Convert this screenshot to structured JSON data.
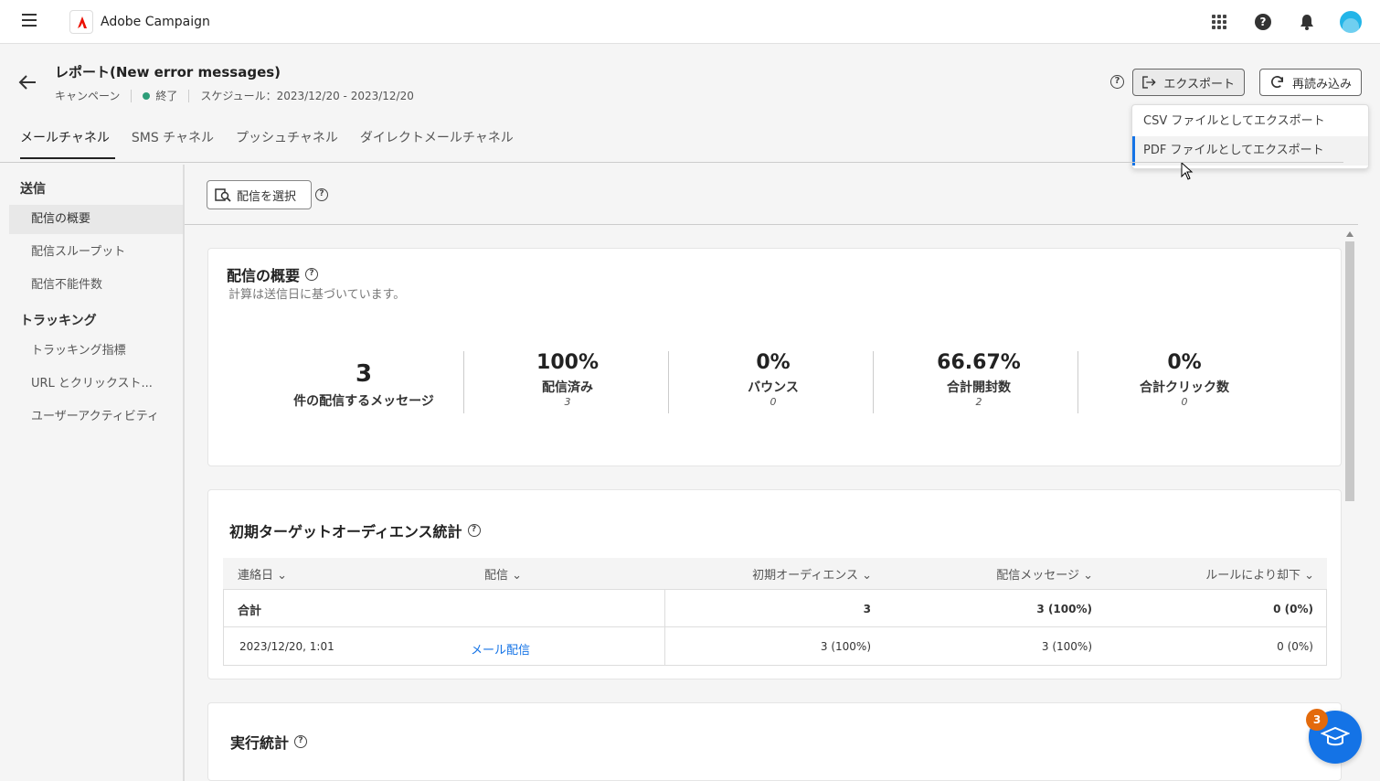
{
  "app": {
    "name": "Adobe Campaign"
  },
  "header": {
    "title": "レポート(New error messages)",
    "breadcrumb": "キャンペーン",
    "status": "終了",
    "schedule": "スケジュール：2023/12/20 - 2023/12/20",
    "export_label": "エクスポート",
    "reload_label": "再読み込み"
  },
  "export_menu": {
    "items": [
      {
        "label": "CSV ファイルとしてエクスポート"
      },
      {
        "label": "PDF ファイルとしてエクスポート"
      }
    ]
  },
  "tabs": [
    {
      "label": "メールチャネル"
    },
    {
      "label": "SMS チャネル"
    },
    {
      "label": "プッシュチャネル"
    },
    {
      "label": "ダイレクトメールチャネル"
    }
  ],
  "sidebar": {
    "section1": "送信",
    "section2": "トラッキング",
    "items": [
      {
        "label": "配信の概要"
      },
      {
        "label": "配信スループット"
      },
      {
        "label": "配信不能件数"
      },
      {
        "label": "トラッキング指標"
      },
      {
        "label": "URL とクリックスト..."
      },
      {
        "label": "ユーザーアクティビティ"
      }
    ]
  },
  "select_delivery_label": "配信を選択",
  "overview": {
    "title": "配信の概要",
    "subtitle": "計算は送信日に基づいています。",
    "kpis": [
      {
        "value": "3",
        "label": "件の配信するメッセージ",
        "sub": ""
      },
      {
        "value": "100%",
        "label": "配信済み",
        "sub": "3"
      },
      {
        "value": "0%",
        "label": "バウンス",
        "sub": "0"
      },
      {
        "value": "66.67%",
        "label": "合計開封数",
        "sub": "2"
      },
      {
        "value": "0%",
        "label": "合計クリック数",
        "sub": "0"
      }
    ]
  },
  "audience": {
    "title": "初期ターゲットオーディエンス統計",
    "columns": [
      "連絡日",
      "配信",
      "初期オーディエンス",
      "配信メッセージ",
      "ルールにより却下"
    ],
    "total_row": {
      "label": "合計",
      "initial": "3",
      "delivered": "3 (100%)",
      "rejected": "0 (0%)"
    },
    "rows": [
      {
        "date": "2023/12/20, 1:01",
        "delivery": "メール配信",
        "initial": "3 (100%)",
        "delivered": "3 (100%)",
        "rejected": "0 (0%)"
      }
    ]
  },
  "execution": {
    "title": "実行統計"
  },
  "fab": {
    "badge": "3"
  },
  "colors": {
    "accent": "#1473e6",
    "status_ok": "#2d9d78",
    "badge": "#e36a0c"
  }
}
